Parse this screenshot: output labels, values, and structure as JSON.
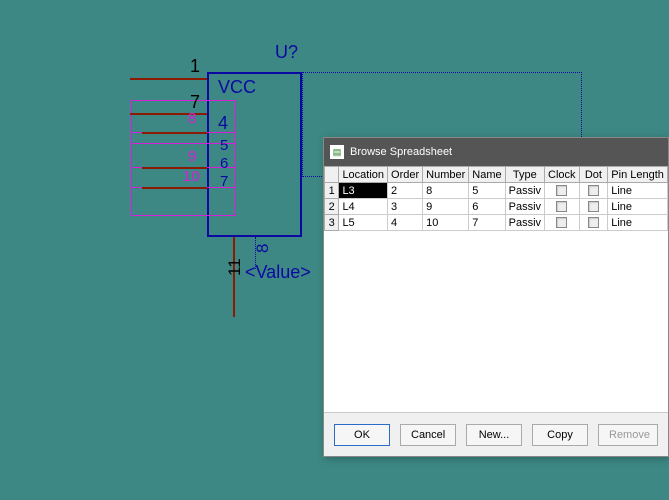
{
  "schematic": {
    "designator": "U?",
    "vcc_label": "VCC",
    "value_label": "<Value>",
    "pins": {
      "p1": "1",
      "p7": "7",
      "p4": "4",
      "p5": "5",
      "p6": "6",
      "p7b": "7",
      "m8": "8",
      "m9": "9",
      "m10": "10",
      "p11": "11",
      "p8": "8"
    }
  },
  "dialog": {
    "title": "Browse Spreadsheet",
    "columns": [
      "Location",
      "Order",
      "Number",
      "Name",
      "Type",
      "Clock",
      "Dot",
      "Pin Length"
    ],
    "rows": [
      {
        "n": "1",
        "location": "L3",
        "order": "2",
        "number": "8",
        "name": "5",
        "type": "Passiv",
        "clock": false,
        "dot": false,
        "len": "Line"
      },
      {
        "n": "2",
        "location": "L4",
        "order": "3",
        "number": "9",
        "name": "6",
        "type": "Passiv",
        "clock": false,
        "dot": false,
        "len": "Line"
      },
      {
        "n": "3",
        "location": "L5",
        "order": "4",
        "number": "10",
        "name": "7",
        "type": "Passiv",
        "clock": false,
        "dot": false,
        "len": "Line"
      }
    ],
    "buttons": {
      "ok": "OK",
      "cancel": "Cancel",
      "new": "New...",
      "copy": "Copy",
      "remove": "Remove"
    }
  }
}
